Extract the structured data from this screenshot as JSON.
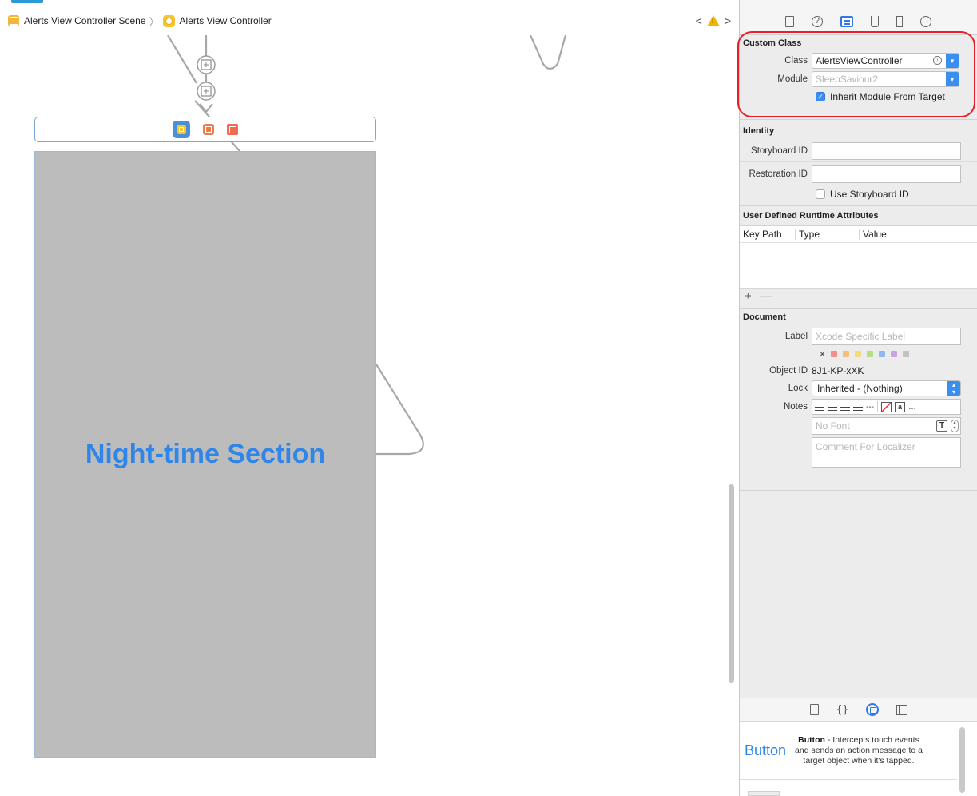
{
  "breadcrumb": {
    "scene": "Alerts View Controller Scene",
    "controller": "Alerts View Controller"
  },
  "canvas": {
    "view_title": "Night-time Section"
  },
  "inspector": {
    "custom_class": {
      "title": "Custom Class",
      "class_label": "Class",
      "class_value": "AlertsViewController",
      "module_label": "Module",
      "module_value": "SleepSaviour2",
      "inherit_label": "Inherit Module From Target",
      "inherit_checked": true
    },
    "identity": {
      "title": "Identity",
      "storyboard_id_label": "Storyboard ID",
      "storyboard_id_value": "",
      "restoration_id_label": "Restoration ID",
      "restoration_id_value": "",
      "use_storyboard_label": "Use Storyboard ID",
      "use_storyboard_checked": false
    },
    "runtime_attributes": {
      "title": "User Defined Runtime Attributes",
      "columns": [
        "Key Path",
        "Type",
        "Value"
      ],
      "add_symbol": "+",
      "remove_symbol": "—"
    },
    "document": {
      "title": "Document",
      "label_label": "Label",
      "label_placeholder": "Xcode Specific Label",
      "swatch_clear": "×",
      "swatch_colors": [
        "#f0908e",
        "#f5c07a",
        "#f2dd7a",
        "#b5df86",
        "#8fb8f0",
        "#c9a4e4",
        "#c2c2c2"
      ],
      "object_id_label": "Object ID",
      "object_id_value": "8J1-KP-xXK",
      "lock_label": "Lock",
      "lock_value": "Inherited - (Nothing)",
      "notes_label": "Notes",
      "notes_more": "…",
      "notes_dashes": "---",
      "font_placeholder": "No Font",
      "comment_placeholder": "Comment For Localizer"
    }
  },
  "library": {
    "items": [
      {
        "title": "Button",
        "name": "Button",
        "description": " - Intercepts touch events and sends an action message to a target object when it's tapped."
      }
    ]
  },
  "colors": {
    "accent": "#3a8ef0",
    "highlight_ring": "#e4202a",
    "view_background": "#bcbcbc",
    "title_text": "#2f86e8"
  }
}
